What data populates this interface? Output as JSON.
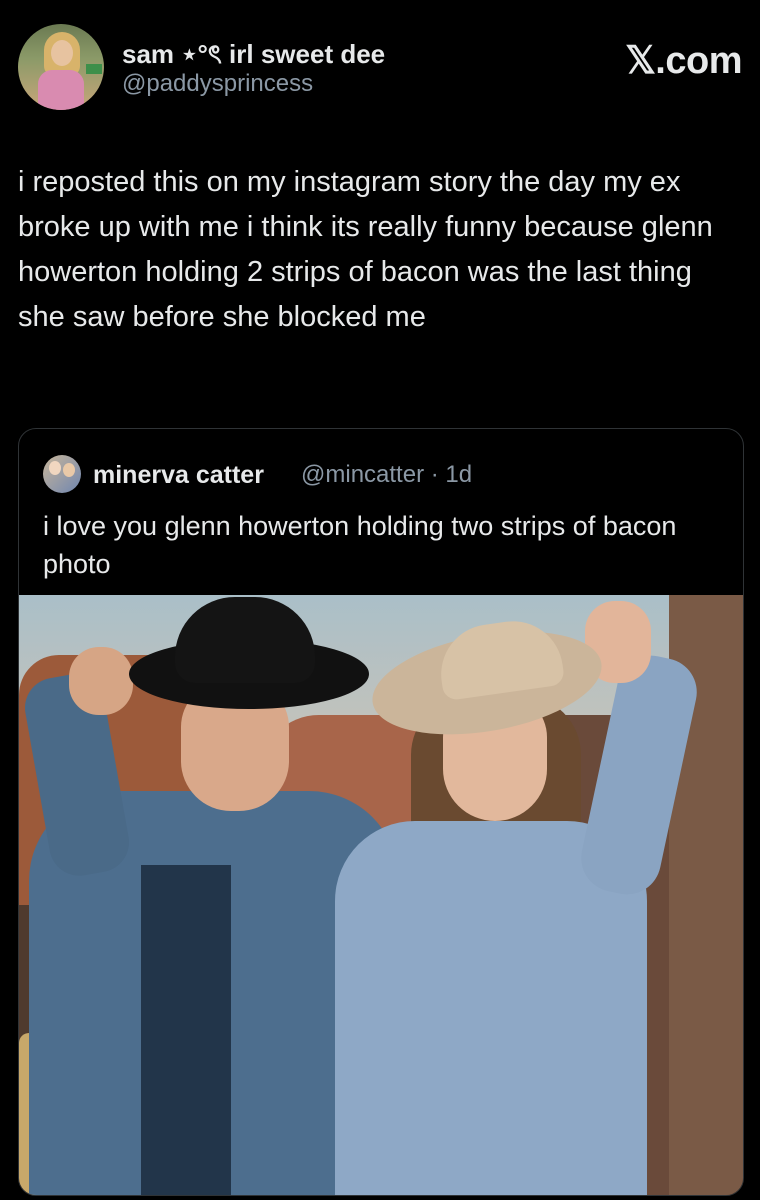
{
  "tweet": {
    "display_name": "sam ⋆°ৎ irl sweet dee",
    "handle": "@paddysprincess",
    "site_label": "𝕏.com",
    "text": "i reposted this on my instagram story the day my ex broke up with me i think its really funny because glenn howerton holding 2 strips of bacon was the last thing she saw before she blocked me"
  },
  "quoted_tweet": {
    "display_name": "minerva catter",
    "handle_and_time": "@mincatter · 1d",
    "text": "i love you glenn howerton holding two strips of bacon photo"
  },
  "colors": {
    "background": "#000000",
    "primary_text": "#e7e9ea",
    "secondary_text": "#8b98a5",
    "border": "#2f3336"
  }
}
